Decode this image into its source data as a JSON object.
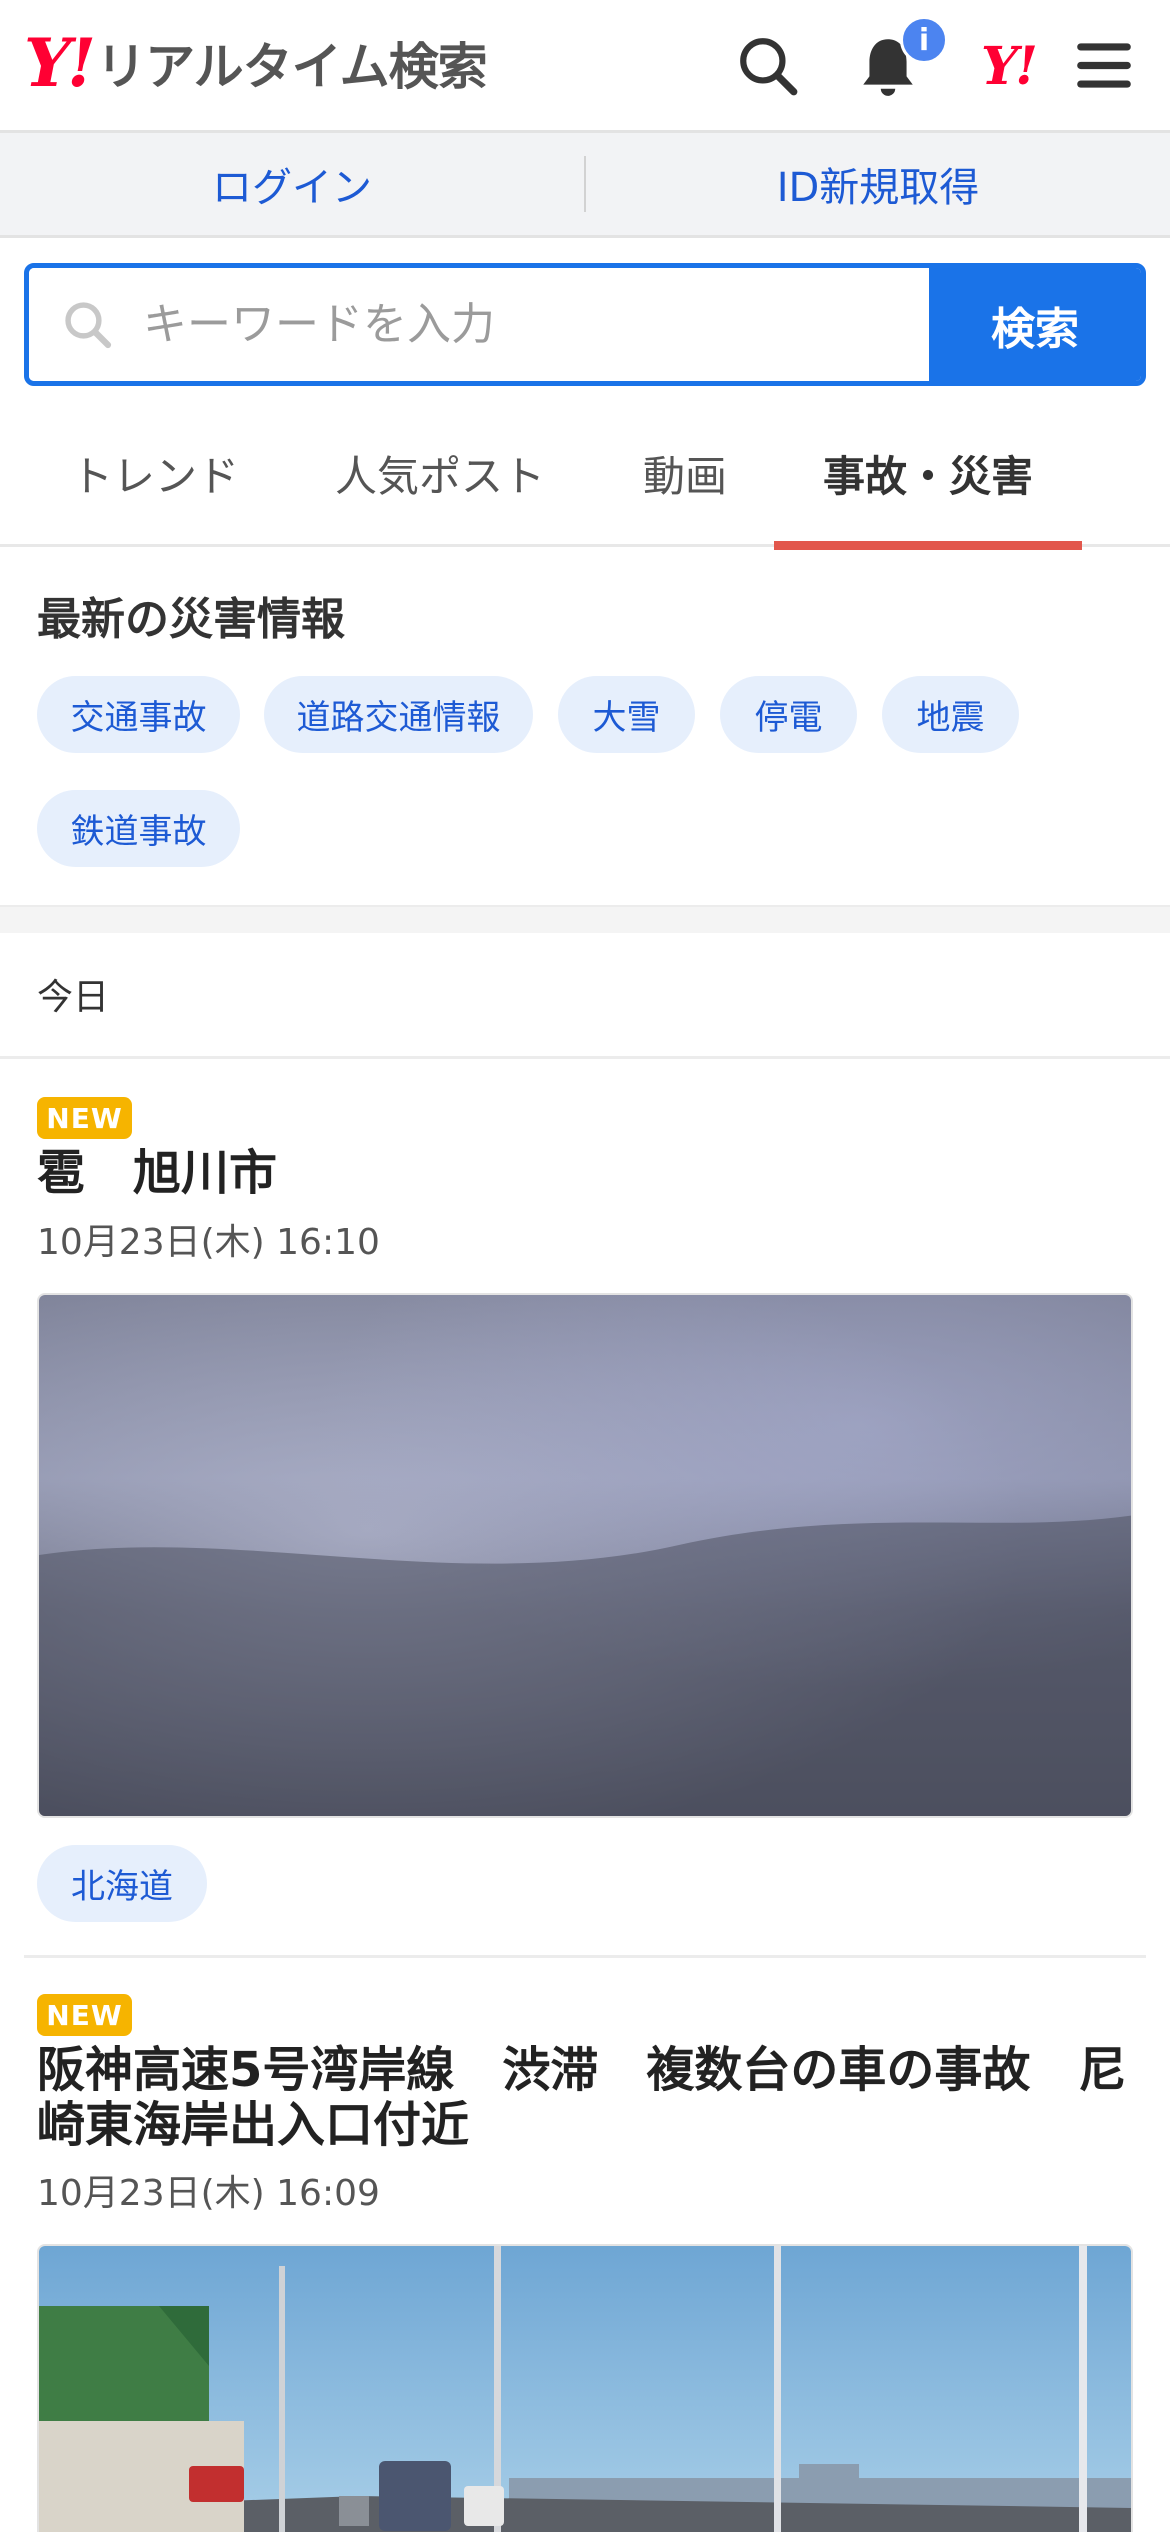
{
  "header": {
    "logo_mark": "Y!",
    "logo_text": "リアルタイム検索",
    "notification_badge": "i",
    "yahoo_small": "Y!"
  },
  "loginbar": {
    "login": "ログイン",
    "register": "ID新規取得"
  },
  "search": {
    "placeholder": "キーワードを入力",
    "button": "検索"
  },
  "tabs": [
    {
      "label": "トレンド"
    },
    {
      "label": "人気ポスト"
    },
    {
      "label": "動画"
    },
    {
      "label": "事故・災害",
      "active": true
    }
  ],
  "disaster": {
    "title": "最新の災害情報",
    "chips": [
      "交通事故",
      "道路交通情報",
      "大雪",
      "停電",
      "地震",
      "鉄道事故"
    ]
  },
  "timeline": {
    "day_label": "今日"
  },
  "articles": [
    {
      "badge": "NEW",
      "title": "雹　旭川市",
      "date": "10月23日(木) 16:10",
      "tag": "北海道"
    },
    {
      "badge": "NEW",
      "title": "阪神高速5号湾岸線　渋滞　複数台の車の事故　尼崎東海岸出入口付近",
      "date": "10月23日(木) 16:09"
    }
  ],
  "colors": {
    "brand_red": "#ff0033",
    "primary_blue": "#1a73e8",
    "link_blue": "#1d5ad4",
    "tab_underline": "#e2574c",
    "new_badge": "#f6b400",
    "chip_bg": "#e6effc"
  }
}
